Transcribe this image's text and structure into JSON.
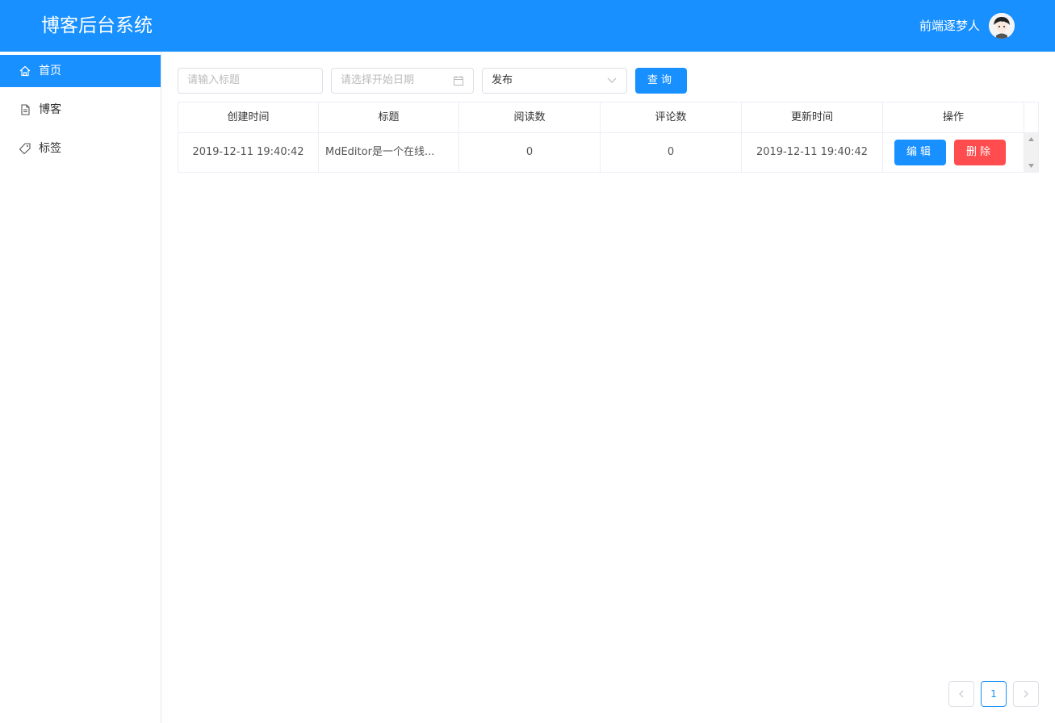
{
  "header": {
    "title": "博客后台系统",
    "user_name": "前端逐梦人"
  },
  "sidebar": {
    "items": [
      {
        "label": "首页",
        "icon": "home-icon",
        "active": true
      },
      {
        "label": "博客",
        "icon": "document-icon",
        "active": false
      },
      {
        "label": "标签",
        "icon": "tag-icon",
        "active": false
      }
    ]
  },
  "filters": {
    "title_placeholder": "请输入标题",
    "date_placeholder": "请选择开始日期",
    "status_value": "发布",
    "search_label": "查询"
  },
  "table": {
    "columns": [
      "创建时间",
      "标题",
      "阅读数",
      "评论数",
      "更新时间",
      "操作"
    ],
    "rows": [
      {
        "created": "2019-12-11 19:40:42",
        "title": "MdEditor是一个在线...",
        "reads": "0",
        "comments": "0",
        "updated": "2019-12-11 19:40:42",
        "edit_label": "编辑",
        "delete_label": "删除"
      }
    ]
  },
  "pagination": {
    "current_page": "1",
    "prev_icon": "chevron-left-icon",
    "next_icon": "chevron-right-icon"
  },
  "colors": {
    "primary": "#1890ff",
    "danger": "#ff4d4f"
  }
}
